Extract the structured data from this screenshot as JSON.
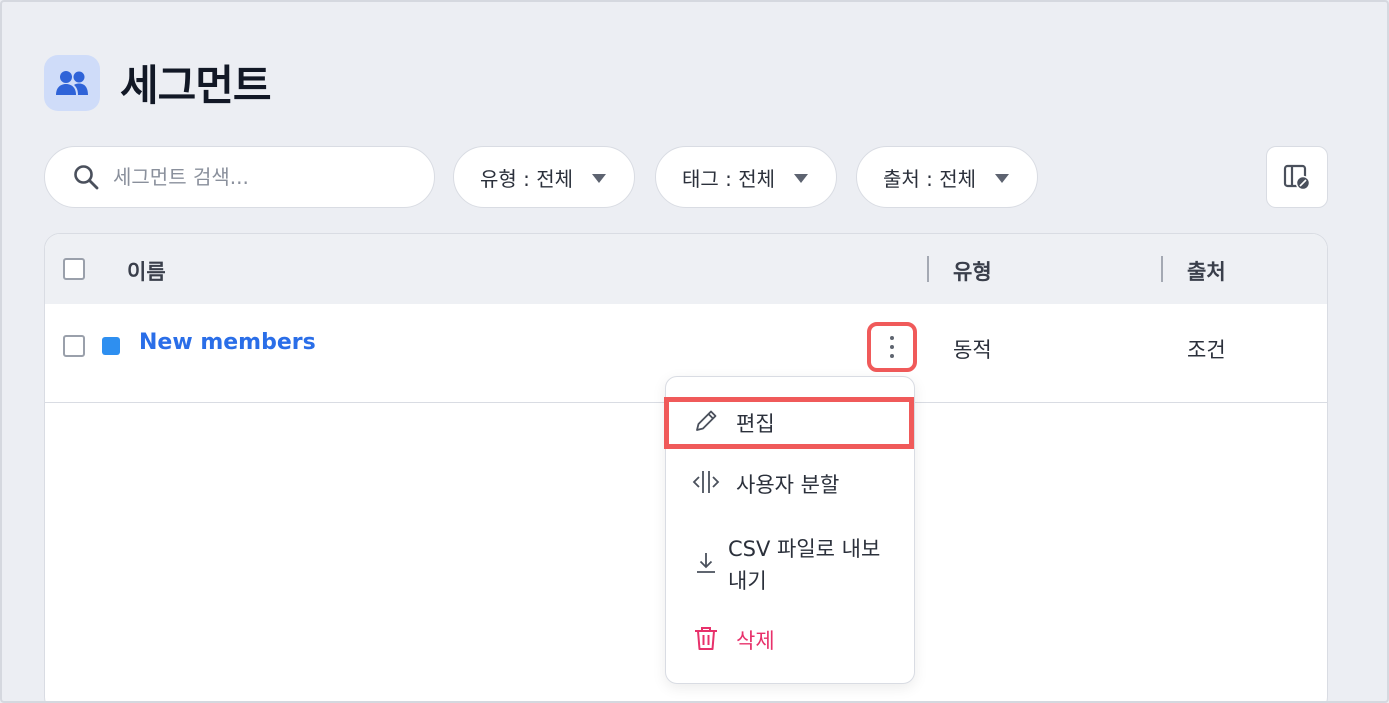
{
  "page": {
    "title": "세그먼트"
  },
  "search": {
    "placeholder": "세그먼트 검색..."
  },
  "filters": [
    {
      "label": "유형 : 전체"
    },
    {
      "label": "태그 : 전체"
    },
    {
      "label": "출처 : 전체"
    }
  ],
  "table": {
    "columns": {
      "name": "이름",
      "type": "유형",
      "source": "출처"
    },
    "rows": [
      {
        "name": "New members",
        "color": "#2e8ff0",
        "type": "동적",
        "source": "조건"
      }
    ]
  },
  "menu": {
    "items": [
      {
        "label": "편집",
        "icon": "pencil-icon"
      },
      {
        "label": "사용자 분할",
        "icon": "split-icon"
      },
      {
        "label": "CSV 파일로 내보내기",
        "icon": "download-icon"
      },
      {
        "label": "삭제",
        "icon": "trash-icon",
        "color": "#e8316b"
      }
    ]
  },
  "colors": {
    "accent": "#2a6ee8",
    "highlight": "#f05a5a",
    "danger": "#e8316b"
  }
}
